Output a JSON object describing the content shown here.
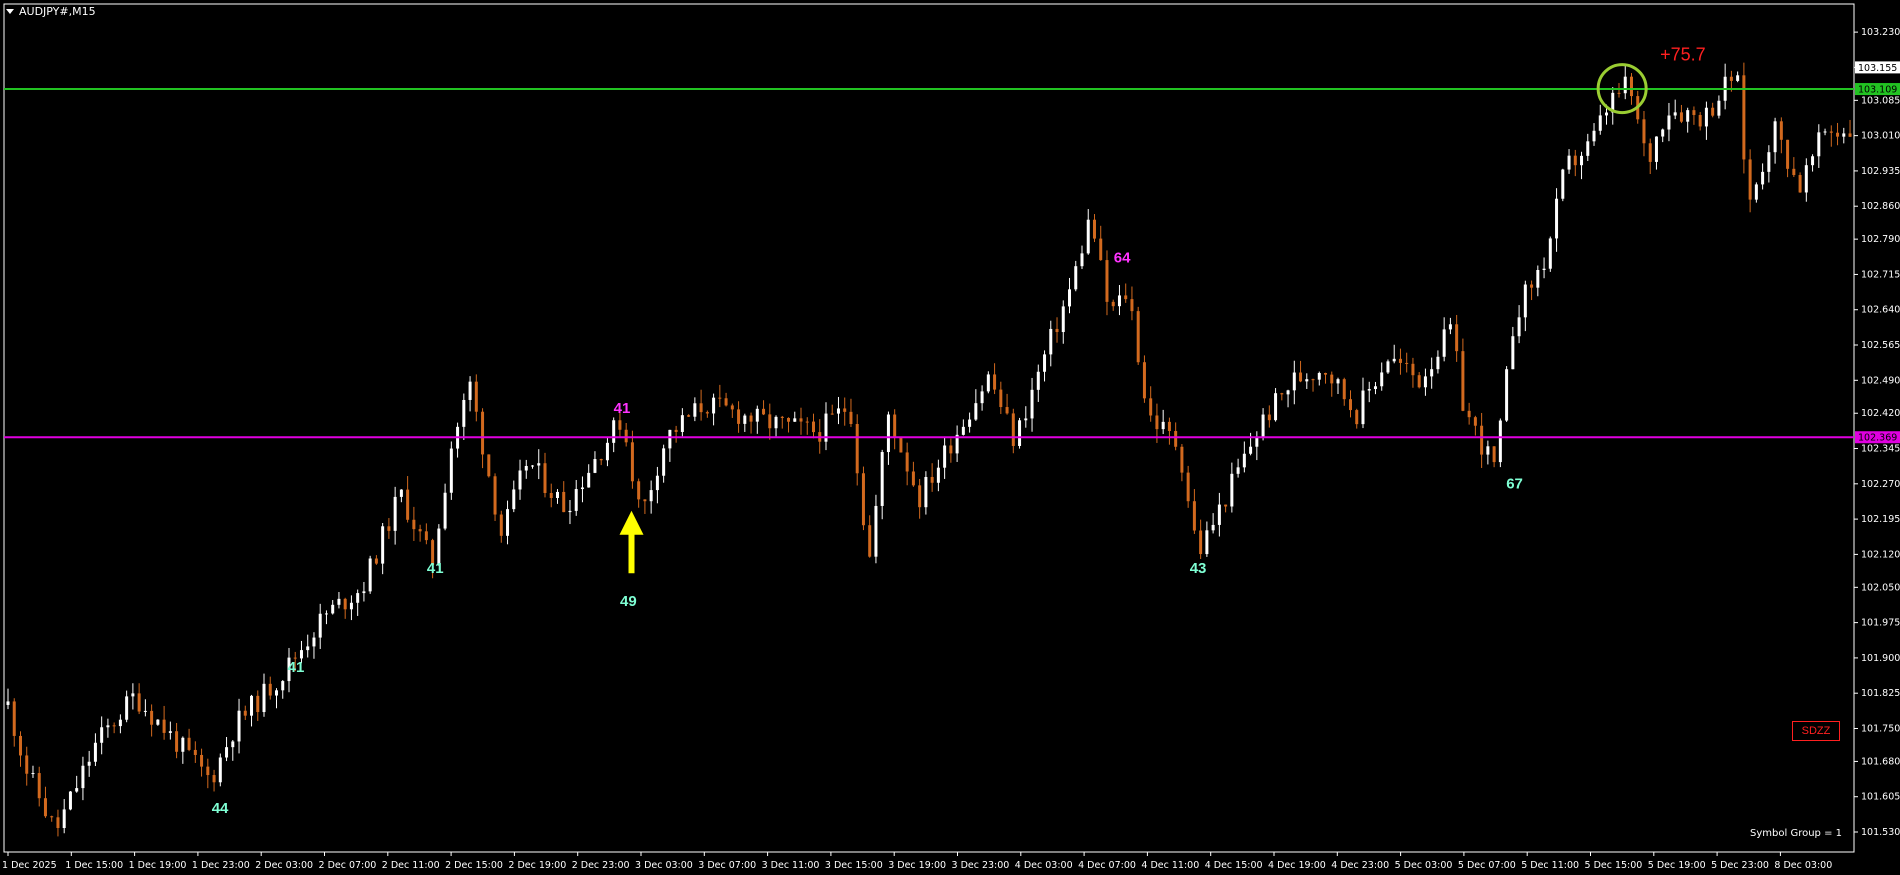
{
  "window": {
    "title": "AUDJPY#,M15",
    "footer": "Symbol Group = 1",
    "badge": "SDZZ"
  },
  "colors": {
    "background": "#000000",
    "bull_candle": "#ffffff",
    "bear_candle": "#d2691e",
    "green_line": "#22c322",
    "magenta_line": "#e000e0",
    "label_cyan": "#7fffd4",
    "label_magenta": "#ff33ff",
    "arrow_yellow": "#ffff00",
    "profit_red": "#ff2020",
    "circle_olive": "#9acd32",
    "axis": "#ffffff"
  },
  "chart_data": {
    "type": "candlestick",
    "symbol": "AUDJPY#",
    "timeframe": "M15",
    "ylim": [
      101.53,
      103.26
    ],
    "yticks": [
      "101.530",
      "101.605",
      "101.680",
      "101.750",
      "101.825",
      "101.900",
      "101.975",
      "102.050",
      "102.120",
      "102.195",
      "102.270",
      "102.345",
      "102.420",
      "102.490",
      "102.565",
      "102.640",
      "102.715",
      "102.790",
      "102.860",
      "102.935",
      "103.010",
      "103.085",
      "103.155",
      "103.230"
    ],
    "xticks": [
      "1 Dec 2025",
      "1 Dec 15:00",
      "1 Dec 19:00",
      "1 Dec 23:00",
      "2 Dec 03:00",
      "2 Dec 07:00",
      "2 Dec 11:00",
      "2 Dec 15:00",
      "2 Dec 19:00",
      "2 Dec 23:00",
      "3 Dec 03:00",
      "3 Dec 07:00",
      "3 Dec 11:00",
      "3 Dec 15:00",
      "3 Dec 19:00",
      "3 Dec 23:00",
      "4 Dec 03:00",
      "4 Dec 07:00",
      "4 Dec 11:00",
      "4 Dec 15:00",
      "4 Dec 19:00",
      "4 Dec 23:00",
      "5 Dec 03:00",
      "5 Dec 07:00",
      "5 Dec 11:00",
      "5 Dec 15:00",
      "5 Dec 19:00",
      "5 Dec 23:00",
      "8 Dec 03:00"
    ],
    "price_path": [
      [
        0,
        101.8
      ],
      [
        0.3,
        101.66
      ],
      [
        0.75,
        101.53
      ],
      [
        1.4,
        101.72
      ],
      [
        2.0,
        101.82
      ],
      [
        2.6,
        101.73
      ],
      [
        3.2,
        101.64
      ],
      [
        3.6,
        101.76
      ],
      [
        4.3,
        101.86
      ],
      [
        5.0,
        101.99
      ],
      [
        5.6,
        102.05
      ],
      [
        6.2,
        102.25
      ],
      [
        6.7,
        102.1
      ],
      [
        7.0,
        102.35
      ],
      [
        7.3,
        102.48
      ],
      [
        7.8,
        102.16
      ],
      [
        8.2,
        102.32
      ],
      [
        8.8,
        102.22
      ],
      [
        9.3,
        102.33
      ],
      [
        9.7,
        102.41
      ],
      [
        10.0,
        102.2
      ],
      [
        10.4,
        102.37
      ],
      [
        11.0,
        102.44
      ],
      [
        12.0,
        102.4
      ],
      [
        12.8,
        102.38
      ],
      [
        13.3,
        102.44
      ],
      [
        13.6,
        102.1
      ],
      [
        13.9,
        102.42
      ],
      [
        14.4,
        102.24
      ],
      [
        14.9,
        102.36
      ],
      [
        15.5,
        102.5
      ],
      [
        15.9,
        102.36
      ],
      [
        16.4,
        102.55
      ],
      [
        16.8,
        102.69
      ],
      [
        17.1,
        102.84
      ],
      [
        17.4,
        102.63
      ],
      [
        17.7,
        102.68
      ],
      [
        18.0,
        102.42
      ],
      [
        18.5,
        102.35
      ],
      [
        18.8,
        102.12
      ],
      [
        19.3,
        102.26
      ],
      [
        19.8,
        102.4
      ],
      [
        20.3,
        102.49
      ],
      [
        20.8,
        102.52
      ],
      [
        21.3,
        102.42
      ],
      [
        21.8,
        102.54
      ],
      [
        22.3,
        102.49
      ],
      [
        22.8,
        102.6
      ],
      [
        23.0,
        102.43
      ],
      [
        23.3,
        102.35
      ],
      [
        23.5,
        102.3
      ],
      [
        23.8,
        102.63
      ],
      [
        24.3,
        102.75
      ],
      [
        24.6,
        102.94
      ],
      [
        25.0,
        102.99
      ],
      [
        25.3,
        103.08
      ],
      [
        25.6,
        103.12
      ],
      [
        25.9,
        102.95
      ],
      [
        26.2,
        103.07
      ],
      [
        26.8,
        103.05
      ],
      [
        27.3,
        103.15
      ],
      [
        27.5,
        102.86
      ],
      [
        27.9,
        103.03
      ],
      [
        28.3,
        102.9
      ],
      [
        28.7,
        103.02
      ],
      [
        29.1,
        103.02
      ]
    ],
    "hlines": [
      {
        "price": 103.109,
        "label": "103.109",
        "color": "green"
      },
      {
        "price": 102.369,
        "label": "102.369",
        "color": "magenta"
      }
    ],
    "current_price": {
      "price": 103.155,
      "label": "103.155"
    },
    "annotations": [
      {
        "text": "44",
        "x": 3.35,
        "y": 101.57,
        "color": "cyan"
      },
      {
        "text": "41",
        "x": 4.55,
        "y": 101.87,
        "color": "cyan"
      },
      {
        "text": "41",
        "x": 6.75,
        "y": 102.08,
        "color": "cyan"
      },
      {
        "text": "49",
        "x": 9.8,
        "y": 102.01,
        "color": "cyan"
      },
      {
        "text": "41",
        "x": 9.7,
        "y": 102.42,
        "color": "magenta"
      },
      {
        "text": "64",
        "x": 17.6,
        "y": 102.74,
        "color": "magenta"
      },
      {
        "text": "43",
        "x": 18.8,
        "y": 102.08,
        "color": "cyan"
      },
      {
        "text": "67",
        "x": 23.8,
        "y": 102.26,
        "color": "cyan"
      }
    ],
    "arrow": {
      "x": 9.85,
      "y_from": 102.08,
      "y_to": 102.2,
      "direction": "up"
    },
    "marker_circle": {
      "x": 25.5,
      "y": 103.11
    },
    "profit_label": {
      "text": "+75.7",
      "x": 26.1,
      "y": 103.17
    }
  }
}
